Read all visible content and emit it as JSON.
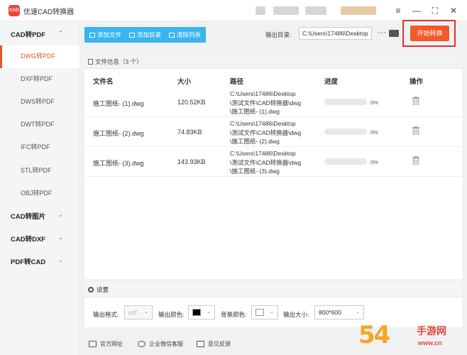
{
  "app": {
    "title": "优速CAD转换器",
    "logo_text": "CAD"
  },
  "window": {
    "menu_icon": "hamburger-icon",
    "minimize": "—",
    "maximize": "⛶",
    "close": "✕"
  },
  "sidebar": {
    "categories": [
      {
        "label": "CAD转PDF",
        "expanded": true,
        "items": [
          "DWG转PDF",
          "DXF转PDF",
          "DWS转PDF",
          "DWT转PDF",
          "IFC转PDF",
          "STL转PDF",
          "OBJ转PDF"
        ]
      },
      {
        "label": "CAD转图片",
        "expanded": false
      },
      {
        "label": "CAD转DXF",
        "expanded": false
      },
      {
        "label": "PDF转CAD",
        "expanded": false
      }
    ],
    "active_item": "DWG转PDF"
  },
  "toolbar": {
    "add_file": "添加文件",
    "add_folder": "添加目录",
    "clear_list": "清除列表",
    "output_label": "输出目录:",
    "output_path": "C:\\Users\\17486\\Desktop",
    "more": "···",
    "start": "开始转换"
  },
  "file_panel": {
    "title": "文件信息（3 个）",
    "columns": [
      "文件名",
      "大小",
      "路径",
      "进度",
      "操作"
    ],
    "rows": [
      {
        "name": "施工图纸- (1).dwg",
        "size": "120.52KB",
        "path": [
          "C:\\Users\\17486\\Desktop",
          "\\测试文件\\CAD转换器\\dwg",
          "\\施工图纸- (1).dwg"
        ],
        "progress": "0%"
      },
      {
        "name": "施工图纸- (2).dwg",
        "size": "74.83KB",
        "path": [
          "C:\\Users\\17486\\Desktop",
          "\\测试文件\\CAD转换器\\dwg",
          "\\施工图纸- (2).dwg"
        ],
        "progress": "0%"
      },
      {
        "name": "施工图纸- (3).dwg",
        "size": "143.93KB",
        "path": [
          "C:\\Users\\17486\\Desktop",
          "\\测试文件\\CAD转换器\\dwg",
          "\\施工图纸- (3).dwg"
        ],
        "progress": "0%"
      }
    ]
  },
  "settings": {
    "title": "设置",
    "format_label": "输出格式:",
    "format_value": "pdf",
    "color_label": "输出颜色:",
    "color_value": "#000000",
    "bg_label": "背景颜色:",
    "bg_value": "#ffffff",
    "size_label": "输出大小:",
    "size_value": "800*600"
  },
  "footer": {
    "website": "官方网址",
    "wechat": "企业微信客服",
    "feedback": "意见反馈"
  },
  "watermark": {
    "digits": "54",
    "cn": "手游网",
    "site": "www.cn"
  }
}
